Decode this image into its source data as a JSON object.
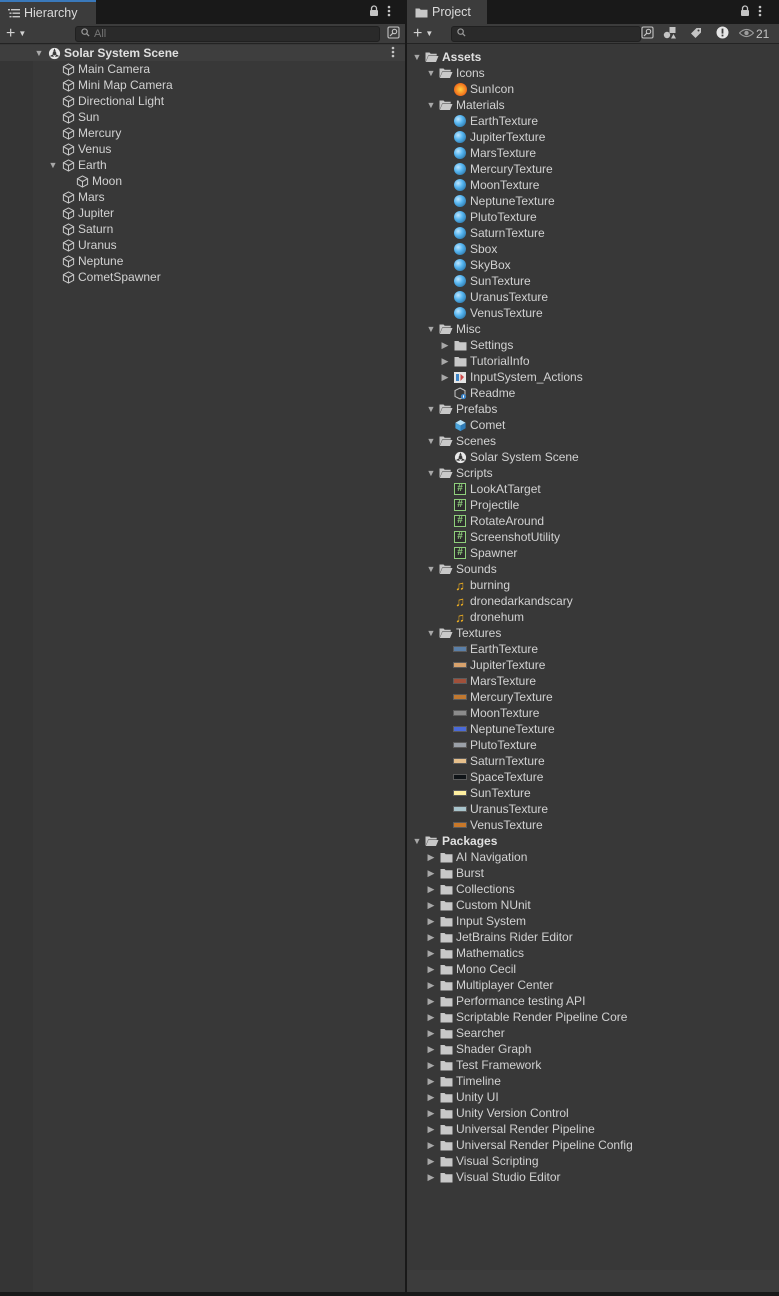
{
  "colors": {
    "panel_bg": "#383838",
    "tab_highlight": "#3a79bb",
    "text": "#d2d2d2"
  },
  "hierarchy": {
    "tab_label": "Hierarchy",
    "search_placeholder": "All",
    "scene_name": "Solar System Scene",
    "items": [
      {
        "label": "Main Camera",
        "depth": 1,
        "expander": "none"
      },
      {
        "label": "Mini Map Camera",
        "depth": 1,
        "expander": "none"
      },
      {
        "label": "Directional Light",
        "depth": 1,
        "expander": "none"
      },
      {
        "label": "Sun",
        "depth": 1,
        "expander": "none"
      },
      {
        "label": "Mercury",
        "depth": 1,
        "expander": "none"
      },
      {
        "label": "Venus",
        "depth": 1,
        "expander": "none"
      },
      {
        "label": "Earth",
        "depth": 1,
        "expander": "expanded"
      },
      {
        "label": "Moon",
        "depth": 2,
        "expander": "none"
      },
      {
        "label": "Mars",
        "depth": 1,
        "expander": "none"
      },
      {
        "label": "Jupiter",
        "depth": 1,
        "expander": "none"
      },
      {
        "label": "Saturn",
        "depth": 1,
        "expander": "none"
      },
      {
        "label": "Uranus",
        "depth": 1,
        "expander": "none"
      },
      {
        "label": "Neptune",
        "depth": 1,
        "expander": "none"
      },
      {
        "label": "CometSpawner",
        "depth": 1,
        "expander": "none"
      }
    ]
  },
  "project": {
    "tab_label": "Project",
    "visibility_count": "21",
    "tree": [
      {
        "label": "Assets",
        "depth": 0,
        "icon": "folder-open-icon",
        "expander": "expanded",
        "bold": true
      },
      {
        "label": "Icons",
        "depth": 1,
        "icon": "folder-open-icon",
        "expander": "expanded"
      },
      {
        "label": "SunIcon",
        "depth": 2,
        "icon": "sun-icon",
        "expander": "none"
      },
      {
        "label": "Materials",
        "depth": 1,
        "icon": "folder-open-icon",
        "expander": "expanded"
      },
      {
        "label": "EarthTexture",
        "depth": 2,
        "icon": "material-icon",
        "expander": "none"
      },
      {
        "label": "JupiterTexture",
        "depth": 2,
        "icon": "material-icon",
        "expander": "none"
      },
      {
        "label": "MarsTexture",
        "depth": 2,
        "icon": "material-icon",
        "expander": "none"
      },
      {
        "label": "MercuryTexture",
        "depth": 2,
        "icon": "material-icon",
        "expander": "none"
      },
      {
        "label": "MoonTexture",
        "depth": 2,
        "icon": "material-icon",
        "expander": "none"
      },
      {
        "label": "NeptuneTexture",
        "depth": 2,
        "icon": "material-icon",
        "expander": "none"
      },
      {
        "label": "PlutoTexture",
        "depth": 2,
        "icon": "material-icon",
        "expander": "none"
      },
      {
        "label": "SaturnTexture",
        "depth": 2,
        "icon": "material-icon",
        "expander": "none"
      },
      {
        "label": "Sbox",
        "depth": 2,
        "icon": "material-icon",
        "expander": "none"
      },
      {
        "label": "SkyBox",
        "depth": 2,
        "icon": "material-icon",
        "expander": "none"
      },
      {
        "label": "SunTexture",
        "depth": 2,
        "icon": "material-icon",
        "expander": "none"
      },
      {
        "label": "UranusTexture",
        "depth": 2,
        "icon": "material-icon",
        "expander": "none"
      },
      {
        "label": "VenusTexture",
        "depth": 2,
        "icon": "material-icon",
        "expander": "none"
      },
      {
        "label": "Misc",
        "depth": 1,
        "icon": "folder-open-icon",
        "expander": "expanded"
      },
      {
        "label": "Settings",
        "depth": 2,
        "icon": "folder-icon",
        "expander": "collapsed"
      },
      {
        "label": "TutorialInfo",
        "depth": 2,
        "icon": "folder-icon",
        "expander": "collapsed"
      },
      {
        "label": "InputSystem_Actions",
        "depth": 2,
        "icon": "input-actions-icon",
        "expander": "collapsed"
      },
      {
        "label": "Readme",
        "depth": 2,
        "icon": "readme-icon",
        "expander": "none"
      },
      {
        "label": "Prefabs",
        "depth": 1,
        "icon": "folder-open-icon",
        "expander": "expanded"
      },
      {
        "label": "Comet",
        "depth": 2,
        "icon": "prefab-icon",
        "expander": "none"
      },
      {
        "label": "Scenes",
        "depth": 1,
        "icon": "folder-open-icon",
        "expander": "expanded"
      },
      {
        "label": "Solar System Scene",
        "depth": 2,
        "icon": "unity-scene-icon",
        "expander": "none"
      },
      {
        "label": "Scripts",
        "depth": 1,
        "icon": "folder-open-icon",
        "expander": "expanded"
      },
      {
        "label": "LookAtTarget",
        "depth": 2,
        "icon": "script-icon",
        "expander": "none"
      },
      {
        "label": "Projectile",
        "depth": 2,
        "icon": "script-icon",
        "expander": "none"
      },
      {
        "label": "RotateAround",
        "depth": 2,
        "icon": "script-icon",
        "expander": "none"
      },
      {
        "label": "ScreenshotUtility",
        "depth": 2,
        "icon": "script-icon",
        "expander": "none"
      },
      {
        "label": "Spawner",
        "depth": 2,
        "icon": "script-icon",
        "expander": "none"
      },
      {
        "label": "Sounds",
        "depth": 1,
        "icon": "folder-open-icon",
        "expander": "expanded"
      },
      {
        "label": "burning",
        "depth": 2,
        "icon": "audio-icon",
        "expander": "none"
      },
      {
        "label": "dronedarkandscary",
        "depth": 2,
        "icon": "audio-icon",
        "expander": "none"
      },
      {
        "label": "dronehum",
        "depth": 2,
        "icon": "audio-icon",
        "expander": "none"
      },
      {
        "label": "Textures",
        "depth": 1,
        "icon": "folder-open-icon",
        "expander": "expanded"
      },
      {
        "label": "EarthTexture",
        "depth": 2,
        "icon": "texture-icon",
        "swatch": "#5a7fa8",
        "expander": "none"
      },
      {
        "label": "JupiterTexture",
        "depth": 2,
        "icon": "texture-icon",
        "swatch": "#d8a26c",
        "expander": "none"
      },
      {
        "label": "MarsTexture",
        "depth": 2,
        "icon": "texture-icon",
        "swatch": "#a0503a",
        "expander": "none"
      },
      {
        "label": "MercuryTexture",
        "depth": 2,
        "icon": "texture-icon",
        "swatch": "#c07830",
        "expander": "none"
      },
      {
        "label": "MoonTexture",
        "depth": 2,
        "icon": "texture-icon",
        "swatch": "#8c8c8c",
        "expander": "none"
      },
      {
        "label": "NeptuneTexture",
        "depth": 2,
        "icon": "texture-icon",
        "swatch": "#4a6ad8",
        "expander": "none"
      },
      {
        "label": "PlutoTexture",
        "depth": 2,
        "icon": "texture-icon",
        "swatch": "#9aa0a8",
        "expander": "none"
      },
      {
        "label": "SaturnTexture",
        "depth": 2,
        "icon": "texture-icon",
        "swatch": "#e6c08c",
        "expander": "none"
      },
      {
        "label": "SpaceTexture",
        "depth": 2,
        "icon": "texture-icon",
        "swatch": "#101418",
        "expander": "none"
      },
      {
        "label": "SunTexture",
        "depth": 2,
        "icon": "texture-icon",
        "swatch": "#fff0a0",
        "expander": "none"
      },
      {
        "label": "UranusTexture",
        "depth": 2,
        "icon": "texture-icon",
        "swatch": "#a8c4cc",
        "expander": "none"
      },
      {
        "label": "VenusTexture",
        "depth": 2,
        "icon": "texture-icon",
        "swatch": "#c8782a",
        "expander": "none"
      },
      {
        "label": "Packages",
        "depth": 0,
        "icon": "folder-open-icon",
        "expander": "expanded",
        "bold": true
      },
      {
        "label": "AI Navigation",
        "depth": 1,
        "icon": "folder-icon",
        "expander": "collapsed"
      },
      {
        "label": "Burst",
        "depth": 1,
        "icon": "folder-icon",
        "expander": "collapsed"
      },
      {
        "label": "Collections",
        "depth": 1,
        "icon": "folder-icon",
        "expander": "collapsed"
      },
      {
        "label": "Custom NUnit",
        "depth": 1,
        "icon": "folder-icon",
        "expander": "collapsed"
      },
      {
        "label": "Input System",
        "depth": 1,
        "icon": "folder-icon",
        "expander": "collapsed"
      },
      {
        "label": "JetBrains Rider Editor",
        "depth": 1,
        "icon": "folder-icon",
        "expander": "collapsed"
      },
      {
        "label": "Mathematics",
        "depth": 1,
        "icon": "folder-icon",
        "expander": "collapsed"
      },
      {
        "label": "Mono Cecil",
        "depth": 1,
        "icon": "folder-icon",
        "expander": "collapsed"
      },
      {
        "label": "Multiplayer Center",
        "depth": 1,
        "icon": "folder-icon",
        "expander": "collapsed"
      },
      {
        "label": "Performance testing API",
        "depth": 1,
        "icon": "folder-icon",
        "expander": "collapsed"
      },
      {
        "label": "Scriptable Render Pipeline Core",
        "depth": 1,
        "icon": "folder-icon",
        "expander": "collapsed"
      },
      {
        "label": "Searcher",
        "depth": 1,
        "icon": "folder-icon",
        "expander": "collapsed"
      },
      {
        "label": "Shader Graph",
        "depth": 1,
        "icon": "folder-icon",
        "expander": "collapsed"
      },
      {
        "label": "Test Framework",
        "depth": 1,
        "icon": "folder-icon",
        "expander": "collapsed"
      },
      {
        "label": "Timeline",
        "depth": 1,
        "icon": "folder-icon",
        "expander": "collapsed"
      },
      {
        "label": "Unity UI",
        "depth": 1,
        "icon": "folder-icon",
        "expander": "collapsed"
      },
      {
        "label": "Unity Version Control",
        "depth": 1,
        "icon": "folder-icon",
        "expander": "collapsed"
      },
      {
        "label": "Universal Render Pipeline",
        "depth": 1,
        "icon": "folder-icon",
        "expander": "collapsed"
      },
      {
        "label": "Universal Render Pipeline Config",
        "depth": 1,
        "icon": "folder-icon",
        "expander": "collapsed"
      },
      {
        "label": "Visual Scripting",
        "depth": 1,
        "icon": "folder-icon",
        "expander": "collapsed"
      },
      {
        "label": "Visual Studio Editor",
        "depth": 1,
        "icon": "folder-icon",
        "expander": "collapsed"
      }
    ]
  }
}
